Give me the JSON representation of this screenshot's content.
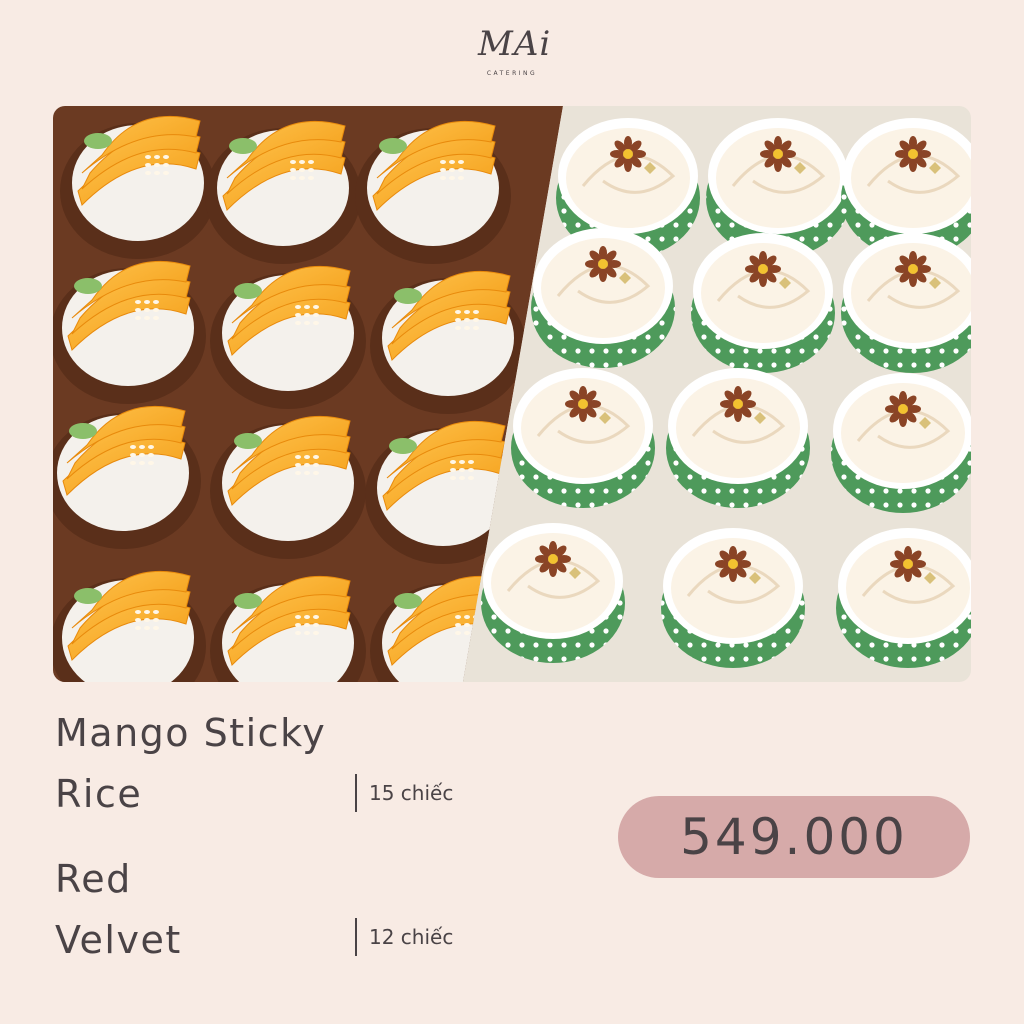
{
  "brand": {
    "logo_text": "MAi",
    "subtitle": "CATERING"
  },
  "photo": {
    "left_item": "mango sticky rice",
    "right_item": "red velvet cupcakes"
  },
  "items": [
    {
      "name_line1": "Mango Sticky",
      "name_line2": "Rice",
      "quantity": "15 chiếc"
    },
    {
      "name_line1": "Red",
      "name_line2": "Velvet",
      "quantity": "12 chiếc"
    }
  ],
  "price": "549.000",
  "colors": {
    "background": "#f8ebe4",
    "text": "#4a4346",
    "price_pill": "#d6aaa9",
    "mango": "#f5a623",
    "frosting": "#fbf3e6",
    "cup_green": "#4e9a5b"
  }
}
